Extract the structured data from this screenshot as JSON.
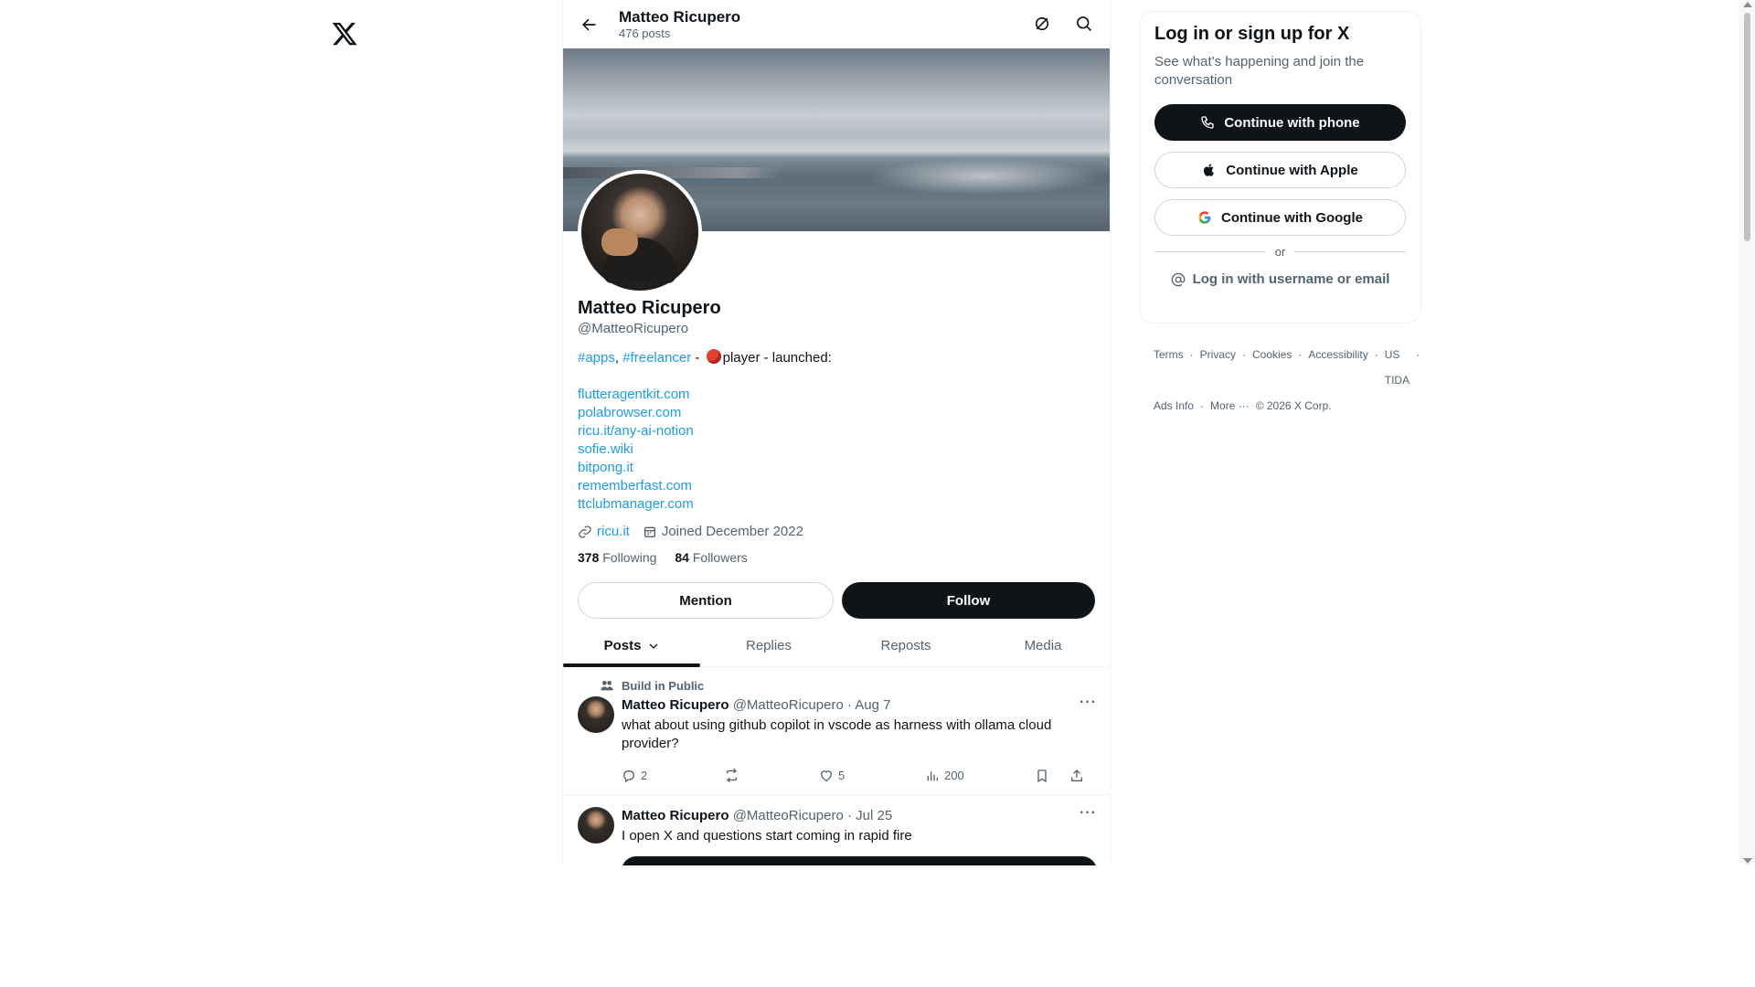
{
  "topbar": {
    "name": "Matteo Ricupero",
    "post_count": "476 posts"
  },
  "profile": {
    "name": "Matteo Ricupero",
    "handle": "@MatteoRicupero",
    "bio_tag1": "#apps",
    "bio_sep": ", ",
    "bio_tag2": "#freelancer",
    "bio_mid": " - ",
    "bio_rest": "player - launched:",
    "bio_links": [
      "flutteragentkit.com",
      "polabrowser.com",
      "ricu.it/any-ai-notion",
      "sofie.wiki",
      "bitpong.it",
      "rememberfast.com",
      "ttclubmanager.com"
    ],
    "website": "ricu.it",
    "joined": "Joined December 2022",
    "following_count": "378",
    "following_label": "Following",
    "followers_count": "84",
    "followers_label": "Followers"
  },
  "buttons": {
    "mention": "Mention",
    "follow": "Follow"
  },
  "tabs": [
    {
      "label": "Posts"
    },
    {
      "label": "Replies"
    },
    {
      "label": "Reposts"
    },
    {
      "label": "Media"
    }
  ],
  "posts": [
    {
      "community": "Build in Public",
      "author": "Matteo Ricupero",
      "handle_date": "@MatteoRicupero · Aug 7",
      "text": "what about using github copilot in vscode as harness with ollama cloud provider?",
      "replies": "2",
      "likes": "5",
      "views": "200"
    },
    {
      "author": "Matteo Ricupero",
      "handle_date": "@MatteoRicupero · Jul 25",
      "text": "I open X and questions start coming in rapid fire"
    }
  ],
  "login": {
    "title": "Log in or sign up for X",
    "subtitle": "See what’s happening and join the conversation",
    "phone": "Continue with phone",
    "apple": "Continue with Apple",
    "google": "Continue with Google",
    "or": "or",
    "username": "Log in with username or email"
  },
  "footer": {
    "row1": [
      "Terms",
      "·",
      "Privacy",
      "·",
      "Cookies",
      "·",
      "Accessibility",
      "·",
      "US TIDA",
      "·"
    ],
    "row2": [
      "Ads Info",
      "·",
      "More ···",
      "© 2026 X Corp."
    ]
  },
  "colors": {
    "accent": "#1d9bf0",
    "text": "#0f1419",
    "muted": "#536471",
    "dark_button": "#0f1419"
  }
}
